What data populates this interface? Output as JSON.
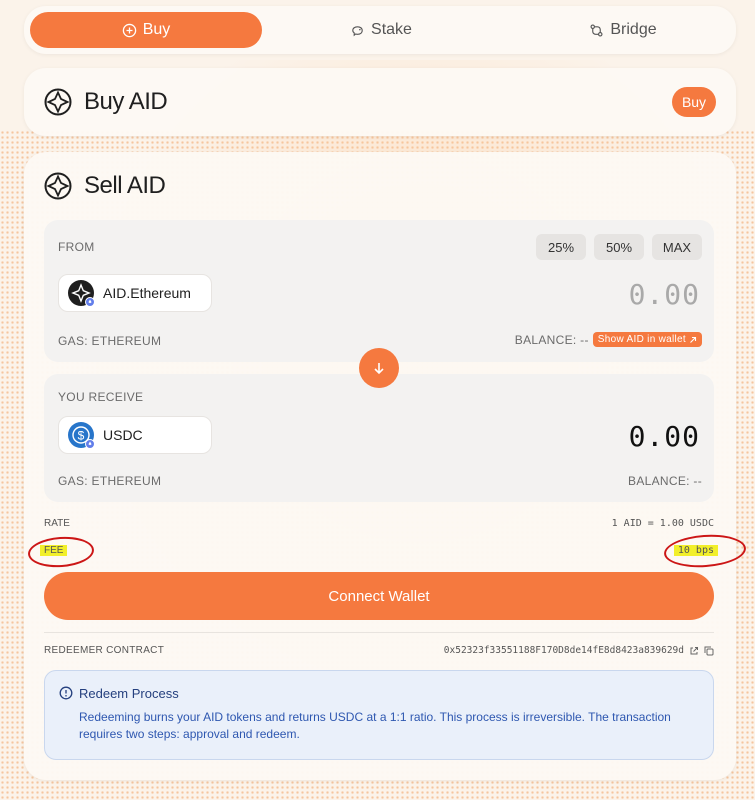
{
  "tabs": [
    {
      "label": "Buy",
      "icon": "plus-circle-icon",
      "active": true
    },
    {
      "label": "Stake",
      "icon": "piggy-bank-icon",
      "active": false
    },
    {
      "label": "Bridge",
      "icon": "bridge-icon",
      "active": false
    }
  ],
  "buy_card": {
    "title": "Buy AID",
    "button": "Buy"
  },
  "sell_card": {
    "title": "Sell AID",
    "from": {
      "label": "FROM",
      "percent_buttons": [
        "25%",
        "50%",
        "MAX"
      ],
      "token": "AID.Ethereum",
      "amount": "0.00",
      "gas": "GAS: ETHEREUM",
      "balance": "BALANCE: --",
      "wallet_link": "Show AID in wallet"
    },
    "receive": {
      "label": "YOU RECEIVE",
      "token": "USDC",
      "amount": "0.00",
      "gas": "GAS: ETHEREUM",
      "balance": "BALANCE: --"
    },
    "rate_label": "RATE",
    "rate_value": "1 AID = 1.00 USDC",
    "fee_label": "FEE",
    "fee_value": "10 bps",
    "connect_button": "Connect Wallet",
    "contract_label": "REDEEMER CONTRACT",
    "contract_address": "0x52323f33551188F170D8de14fE8d8423a839629d",
    "notice": {
      "title": "Redeem Process",
      "body": "Redeeming burns your AID tokens and returns USDC at a 1:1 ratio. This process is irreversible. The transaction requires two steps: approval and redeem."
    }
  },
  "colors": {
    "accent": "#f5793f",
    "highlight": "#f2ef2a",
    "annotation": "#cc1616",
    "notice_text": "#2e57b0"
  }
}
